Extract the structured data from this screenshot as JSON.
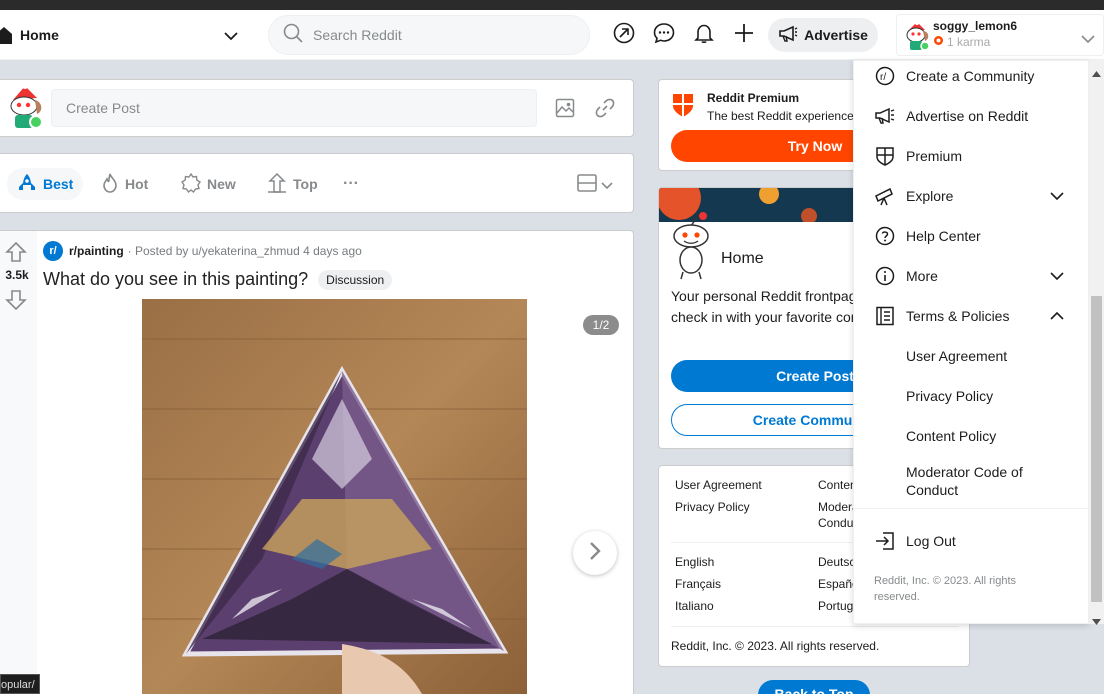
{
  "header": {
    "home_label": "Home",
    "search_placeholder": "Search Reddit",
    "advertise_label": "Advertise",
    "user": {
      "name": "soggy_lemon6",
      "karma": "1 karma"
    }
  },
  "create_post": {
    "placeholder": "Create Post"
  },
  "sort": {
    "best": "Best",
    "hot": "Hot",
    "new": "New",
    "top": "Top",
    "more": "···"
  },
  "post": {
    "votes": "3.5k",
    "subreddit": "r/painting",
    "posted_by": "· Posted by u/yekaterina_zhmud 4 days ago",
    "title": "What do you see in this painting?",
    "flair": "Discussion",
    "gallery_counter": "1/2",
    "sr_icon_letter": "r/"
  },
  "status_url": "opular/",
  "premium": {
    "title": "Reddit Premium",
    "subtitle": "The best Reddit experience",
    "button": "Try Now"
  },
  "home_card": {
    "title": "Home",
    "description": "Your personal Reddit frontpage. Come here to check in with your favorite communities.",
    "create_post": "Create Post",
    "create_community": "Create Community"
  },
  "footer": {
    "col1": [
      "User Agreement",
      "Privacy Policy"
    ],
    "col2": [
      "Content Policy",
      "Moderator Code of Conduct"
    ],
    "lang1": [
      "English",
      "Français",
      "Italiano"
    ],
    "lang2": [
      "Deutsch",
      "Español",
      "Português"
    ],
    "copyright": "Reddit, Inc. © 2023. All rights reserved."
  },
  "back_to_top": "Back to Top",
  "dropdown": {
    "items": [
      "Create a Community",
      "Advertise on Reddit",
      "Premium",
      "Explore",
      "Help Center",
      "More",
      "Terms & Policies"
    ],
    "sub_items": [
      "User Agreement",
      "Privacy Policy",
      "Content Policy",
      "Moderator Code of Conduct"
    ],
    "logout": "Log Out",
    "copyright": "Reddit, Inc. © 2023. All rights reserved."
  },
  "colors": {
    "brand_orange": "#ff4500",
    "brand_blue": "#0079d3",
    "page_bg": "#dae0e6"
  }
}
